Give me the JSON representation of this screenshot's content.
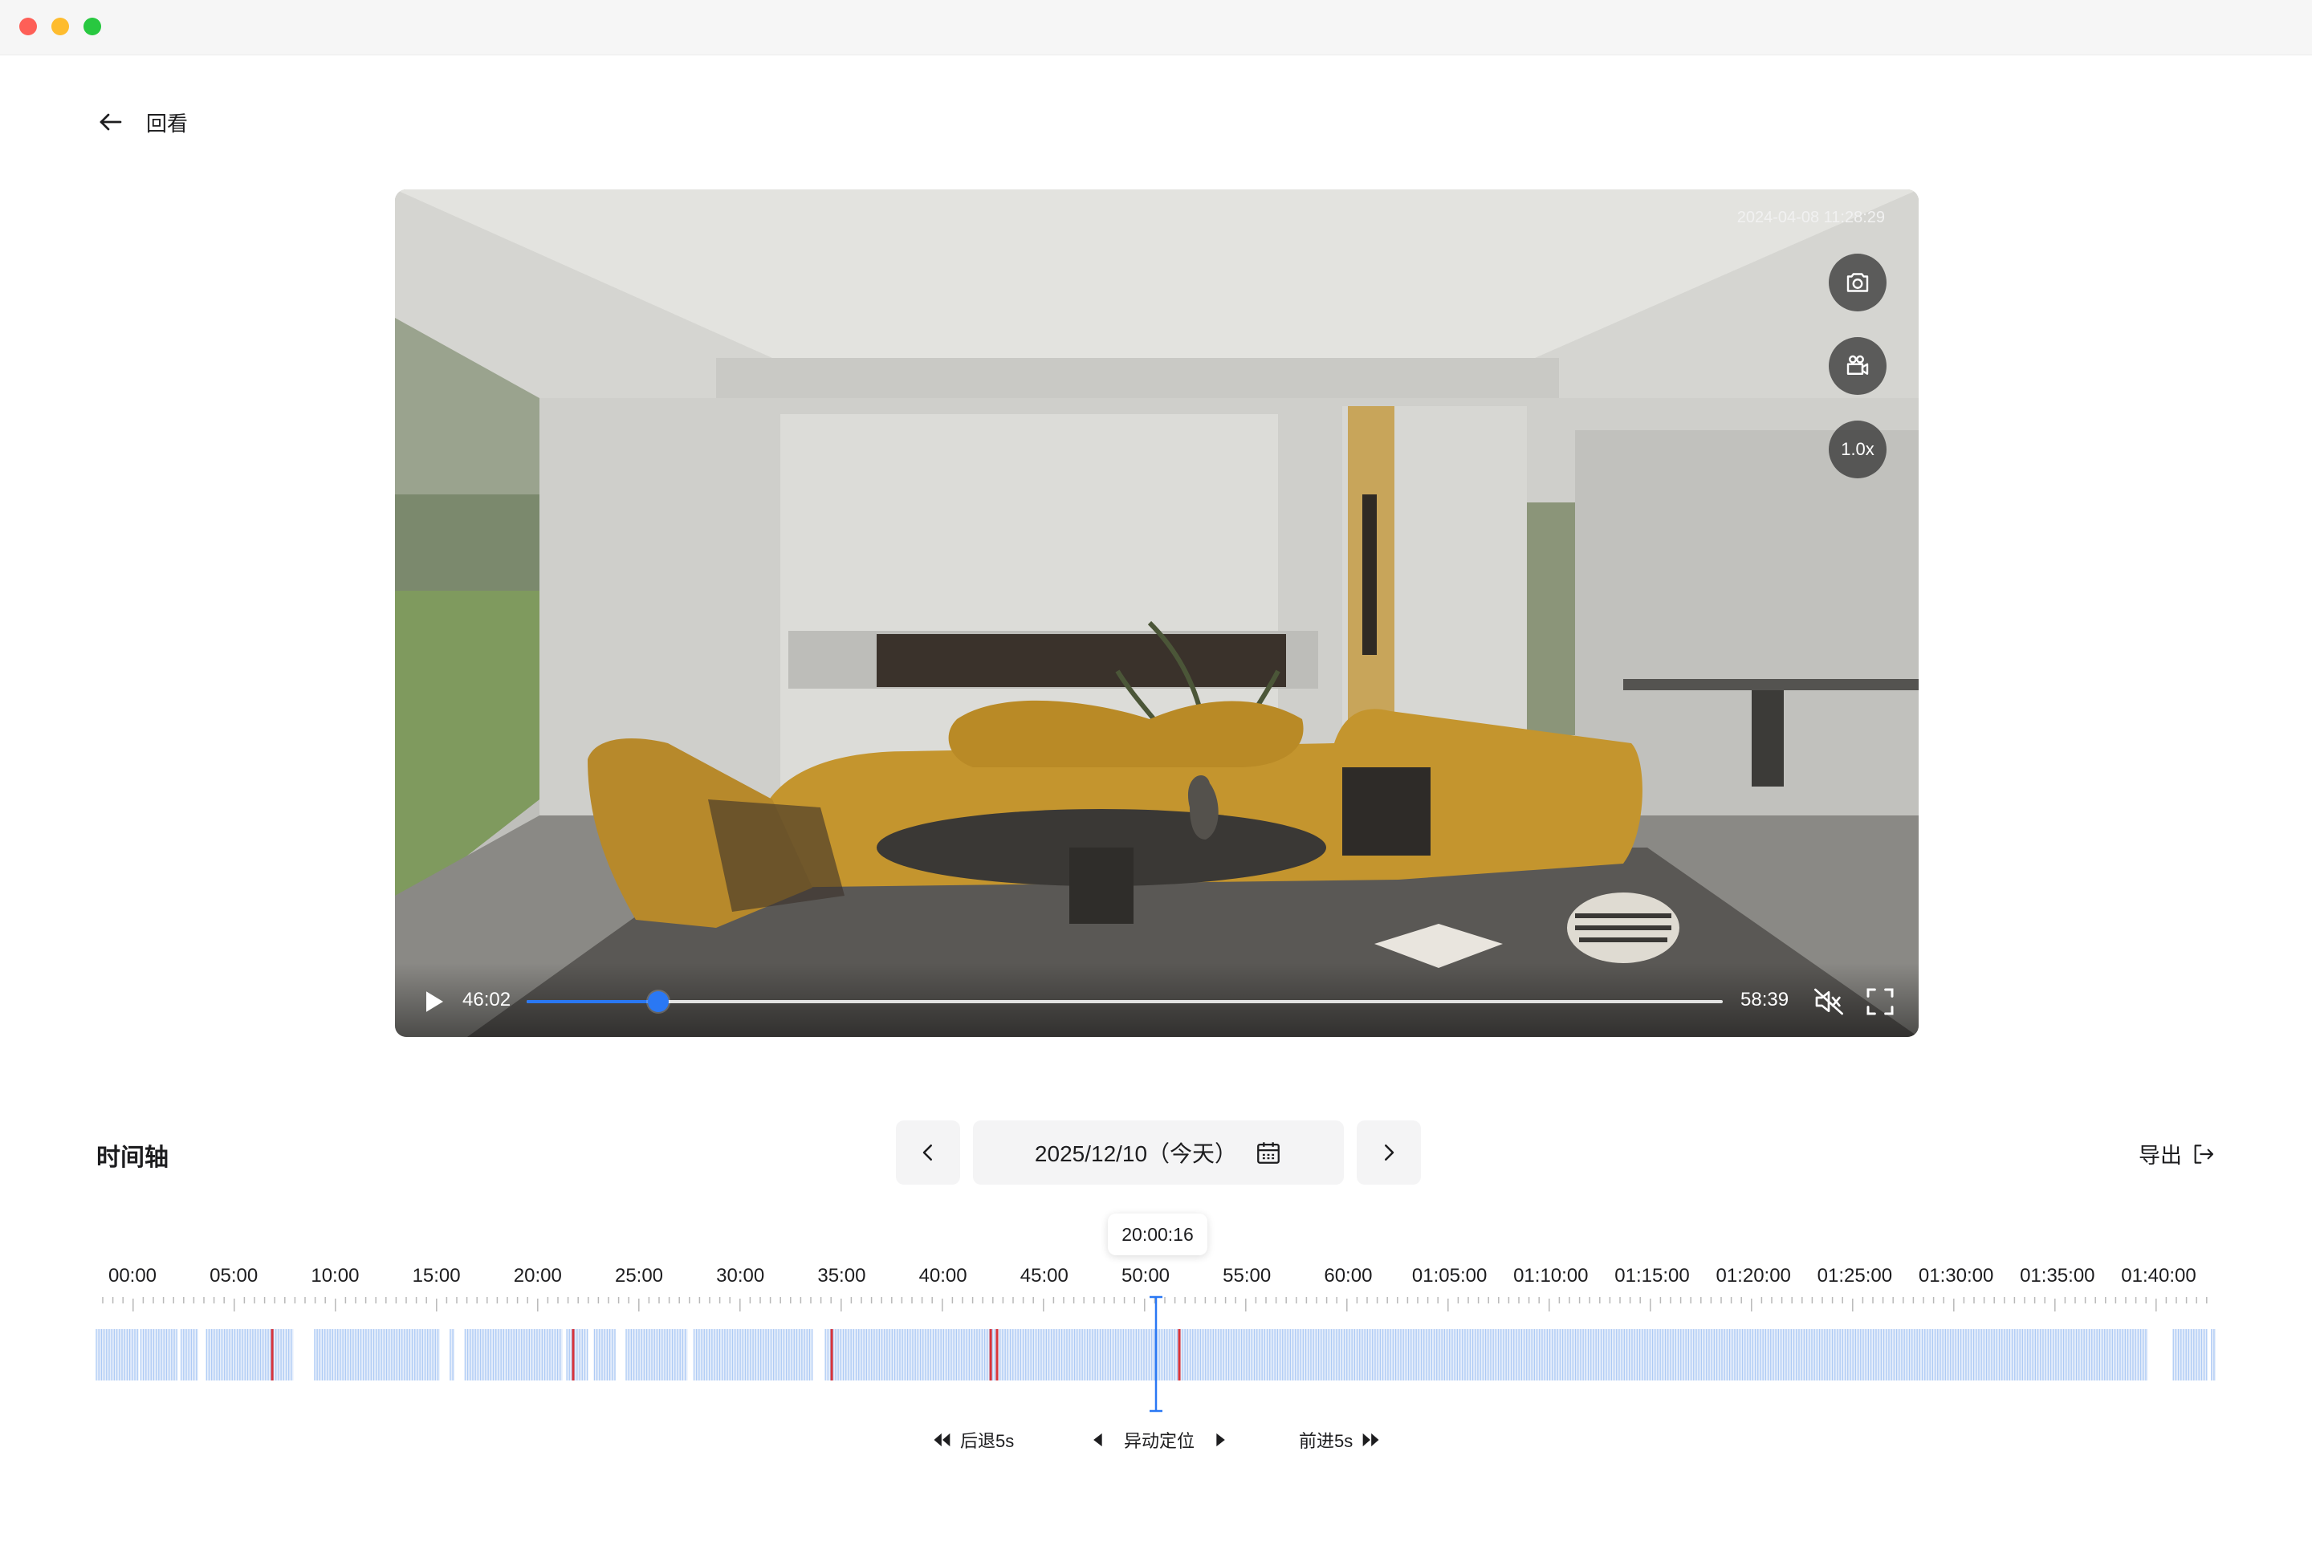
{
  "window": {
    "controls": [
      "close",
      "minimize",
      "zoom"
    ]
  },
  "header": {
    "back_label": "回看",
    "back_icon": "arrow-left-icon"
  },
  "player": {
    "timestamp": "2024-04-08 11:28:29",
    "speed_label": "1.0x",
    "current_time": "46:02",
    "duration": "58:39",
    "progress": 0.11,
    "icons": [
      "camera-icon",
      "record-icon",
      "play-icon",
      "mute-icon",
      "fullscreen-icon"
    ]
  },
  "timeline": {
    "title": "时间轴",
    "date": "2025/12/10（今天）",
    "export_label": "导出",
    "cursor_time": "20:00:16",
    "ticks": [
      "00:00",
      "05:00",
      "10:00",
      "15:00",
      "20:00",
      "25:00",
      "30:00",
      "35:00",
      "40:00",
      "45:00",
      "50:00",
      "55:00",
      "60:00",
      "01:05:00",
      "01:10:00",
      "01:15:00",
      "01:20:00",
      "01:25:00",
      "01:30:00",
      "01:35:00",
      "01:40:00"
    ],
    "cursor_position": 0.5,
    "recording_segments": [
      [
        0.0,
        0.02
      ],
      [
        0.021,
        0.038
      ],
      [
        0.04,
        0.048
      ],
      [
        0.052,
        0.093
      ],
      [
        0.103,
        0.162
      ],
      [
        0.167,
        0.169
      ],
      [
        0.174,
        0.22
      ],
      [
        0.222,
        0.232
      ],
      [
        0.235,
        0.245
      ],
      [
        0.25,
        0.279
      ],
      [
        0.282,
        0.338
      ],
      [
        0.344,
        0.968
      ],
      [
        0.98,
        0.996
      ],
      [
        0.998,
        1.0
      ]
    ],
    "alert_markers": [
      0.083,
      0.225,
      0.347,
      0.422,
      0.425,
      0.511
    ],
    "controls": {
      "rewind": "后退5s",
      "locate": "异动定位",
      "forward": "前进5s"
    }
  },
  "colors": {
    "accent": "#2a78f4",
    "recording": "#aecbf5",
    "alert": "#d9343a"
  }
}
